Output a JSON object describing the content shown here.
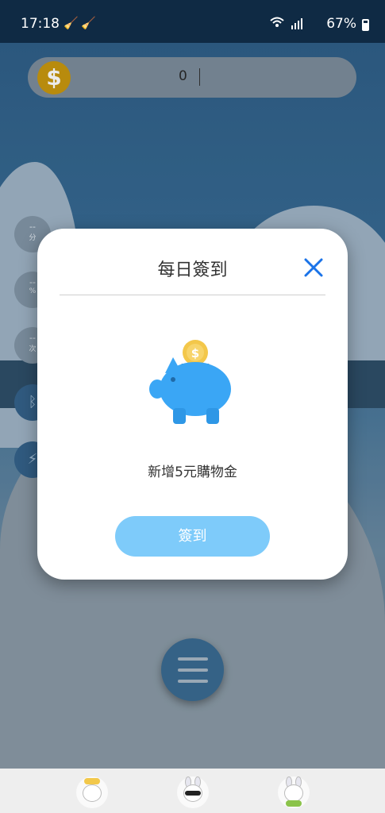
{
  "status_bar": {
    "time": "17:18",
    "battery": "67%"
  },
  "coin_bar": {
    "coin_symbol": "$",
    "coin_count": "0"
  },
  "side_stats": [
    {
      "value": "--",
      "unit": "分"
    },
    {
      "value": "--",
      "unit": "%"
    },
    {
      "value": "--",
      "unit": "次"
    }
  ],
  "side_icons": [
    "bluetooth-icon",
    "lightning-icon"
  ],
  "dialog": {
    "title": "每日簽到",
    "message": "新增5元購物金",
    "button_label": "簽到",
    "close_icon": "close-icon",
    "illustration": "piggy-bank-icon"
  },
  "bottom_nav": {
    "tabs": [
      "tab-character-yellow-bow",
      "tab-character-sunglasses",
      "tab-character-green-bow"
    ]
  },
  "colors": {
    "accent": "#1a73e8",
    "button": "#7ecbfa",
    "pig": "#3aa6f5",
    "coin": "#f3c74a"
  }
}
